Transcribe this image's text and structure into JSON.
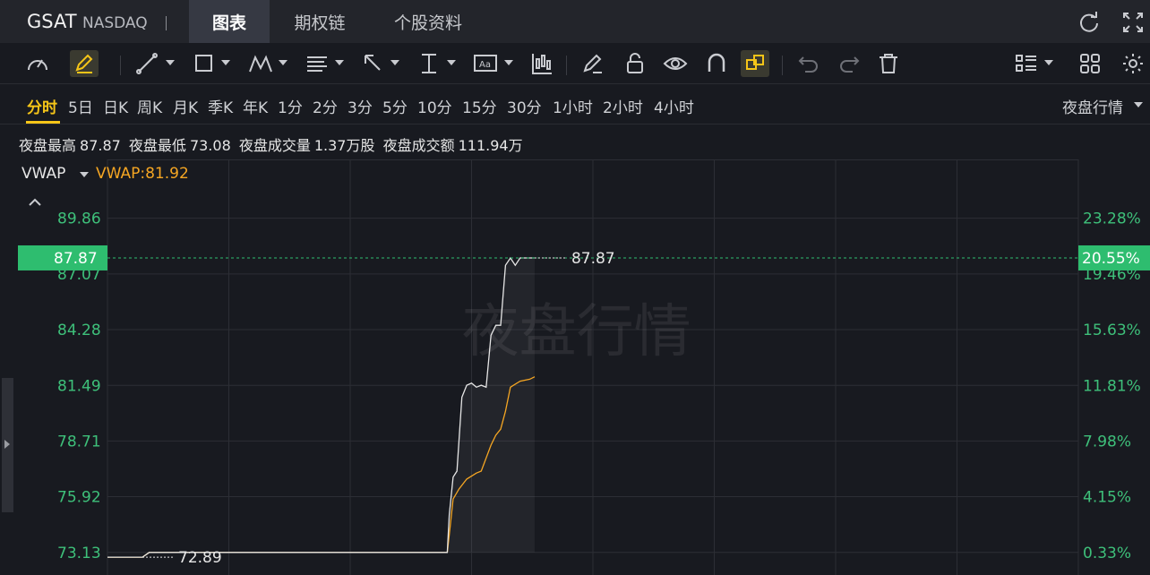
{
  "header": {
    "symbol": "GSAT",
    "exchange": "NASDAQ",
    "tabs": [
      "图表",
      "期权链",
      "个股资料"
    ],
    "active_tab": "图表"
  },
  "toolbar": {
    "icons": [
      "speedometer-icon",
      "pencil-edit-icon",
      "trend-line-icon",
      "rectangle-icon",
      "pattern-icon",
      "fib-lines-icon",
      "arrow-icon",
      "measure-icon",
      "text-icon",
      "candles-icon",
      "eraser-pen-icon",
      "lock-icon",
      "eye-icon",
      "magnet-icon",
      "link-icon",
      "undo-icon",
      "redo-icon",
      "trash-icon",
      "layout-list-icon",
      "grid-icon",
      "settings-icon"
    ],
    "active_tool": "pencil-edit-icon",
    "highlighted_tool": "link-icon"
  },
  "intervals": {
    "items": [
      "分时",
      "5日",
      "日K",
      "周K",
      "月K",
      "季K",
      "年K",
      "1分",
      "2分",
      "3分",
      "5分",
      "10分",
      "15分",
      "30分",
      "1小时",
      "2小时",
      "4小时"
    ],
    "selected": "分时",
    "session_label": "夜盘行情"
  },
  "stats": {
    "high_label": "夜盘最高",
    "high_value": "87.87",
    "low_label": "夜盘最低",
    "low_value": "73.08",
    "volume_label": "夜盘成交量",
    "volume_value": "1.37万股",
    "turnover_label": "夜盘成交额",
    "turnover_value": "111.94万"
  },
  "indicator": {
    "name": "VWAP",
    "value_text": "VWAP:81.92",
    "color": "#f5a623"
  },
  "watermark": "夜盘行情",
  "colors": {
    "price_line": "#e6e6e6",
    "vwap_line": "#f5a623",
    "axis_text": "#3ec07a",
    "current_price_badge": "#2ebd6f",
    "selected_interval": "#f5c518"
  },
  "chart_data": {
    "type": "line",
    "price_axis_ticks": [
      "89.86",
      "87.07",
      "84.28",
      "81.49",
      "78.71",
      "75.92",
      "73.13"
    ],
    "percent_axis_ticks": [
      "23.28%",
      "19.46%",
      "15.63%",
      "11.81%",
      "7.98%",
      "4.15%",
      "0.33%"
    ],
    "ylim": [
      72.0,
      92.8
    ],
    "current_price": "87.87",
    "current_percent": "20.55%",
    "high_marker": "87.87",
    "low_marker": "72.89",
    "series": [
      {
        "name": "VWAP",
        "color": "#f5a623",
        "points": [
          [
            0,
            72.89
          ],
          [
            0.036,
            72.89
          ],
          [
            0.043,
            73.13
          ],
          [
            0.35,
            73.13
          ],
          [
            0.352,
            74.0
          ],
          [
            0.356,
            75.8
          ],
          [
            0.362,
            76.3
          ],
          [
            0.37,
            76.8
          ],
          [
            0.38,
            77.1
          ],
          [
            0.385,
            77.2
          ],
          [
            0.395,
            78.5
          ],
          [
            0.4,
            79.0
          ],
          [
            0.405,
            79.3
          ],
          [
            0.41,
            80.2
          ],
          [
            0.415,
            81.4
          ],
          [
            0.425,
            81.7
          ],
          [
            0.435,
            81.8
          ],
          [
            0.44,
            81.92
          ]
        ]
      },
      {
        "name": "Price",
        "color": "#e6e6e6",
        "points": [
          [
            0,
            72.89
          ],
          [
            0.036,
            72.89
          ],
          [
            0.043,
            73.13
          ],
          [
            0.35,
            73.13
          ],
          [
            0.352,
            75.0
          ],
          [
            0.356,
            76.9
          ],
          [
            0.36,
            77.2
          ],
          [
            0.365,
            80.9
          ],
          [
            0.37,
            81.5
          ],
          [
            0.375,
            81.6
          ],
          [
            0.38,
            81.4
          ],
          [
            0.385,
            81.5
          ],
          [
            0.39,
            81.4
          ],
          [
            0.395,
            84.0
          ],
          [
            0.4,
            84.5
          ],
          [
            0.405,
            84.5
          ],
          [
            0.41,
            87.5
          ],
          [
            0.415,
            87.87
          ],
          [
            0.42,
            87.5
          ],
          [
            0.425,
            87.87
          ],
          [
            0.44,
            87.87
          ]
        ]
      }
    ]
  }
}
